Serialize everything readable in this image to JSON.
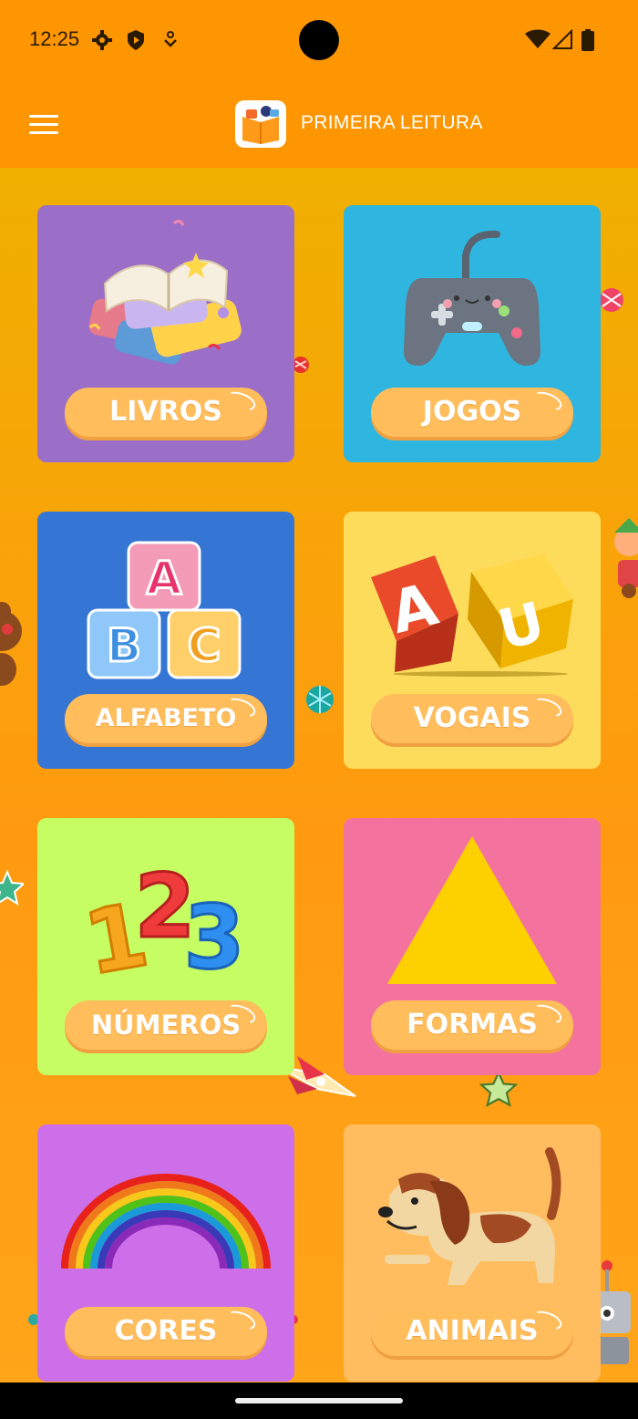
{
  "status": {
    "time": "12:25",
    "icons": [
      "gear-icon",
      "shield-icon",
      "download-icon",
      "wifi-icon",
      "signal-icon",
      "battery-icon"
    ]
  },
  "appbar": {
    "title": "PRIMEIRA LEITURA",
    "menu_icon": "hamburger-menu-icon",
    "logo_icon": "open-book-logo-icon"
  },
  "colors": {
    "appbar": "#fd9600",
    "pill": "#ffbd5c",
    "livros": "#9b6fc8",
    "jogos": "#2fb6e0",
    "alfabeto": "#3575d3",
    "vogais": "#fddc5c",
    "numeros": "#c6fd62",
    "formas": "#f4739e",
    "cores": "#cd6fe8",
    "animais": "#ffbd60"
  },
  "tiles": {
    "livros": {
      "label": "LIVROS",
      "icon": "books-icon"
    },
    "jogos": {
      "label": "JOGOS",
      "icon": "gamepad-icon"
    },
    "alfabeto": {
      "label": "ALFABETO",
      "icon": "abc-blocks-icon"
    },
    "vogais": {
      "label": "VOGAIS",
      "icon": "vowel-blocks-icon"
    },
    "numeros": {
      "label": "NÚMEROS",
      "icon": "numbers-123-icon"
    },
    "formas": {
      "label": "FORMAS",
      "icon": "triangle-icon"
    },
    "cores": {
      "label": "CORES",
      "icon": "rainbow-icon"
    },
    "animais": {
      "label": "ANIMAIS",
      "icon": "dog-icon"
    }
  }
}
